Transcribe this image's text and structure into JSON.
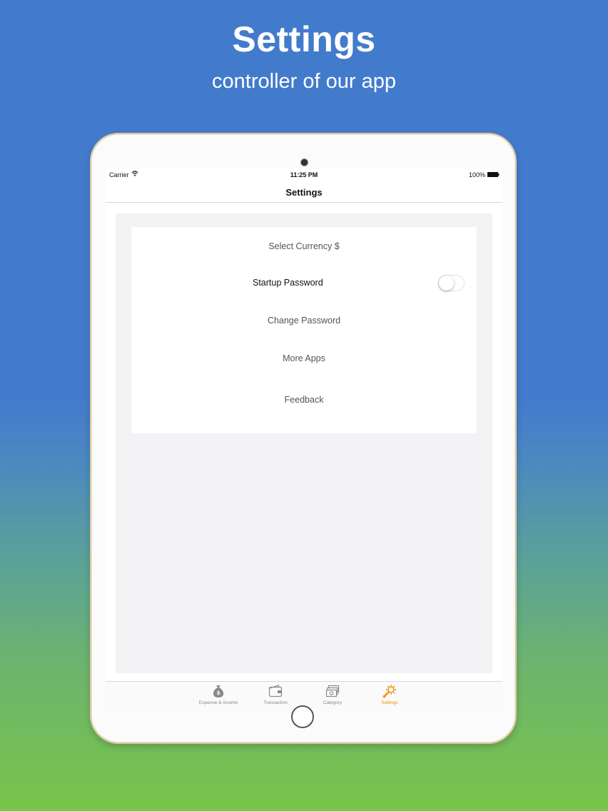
{
  "promo": {
    "title": "Settings",
    "subtitle": "controller of our app"
  },
  "status_bar": {
    "carrier": "Carrier",
    "time": "11:25 PM",
    "battery": "100%"
  },
  "nav": {
    "title": "Settings"
  },
  "settings": {
    "select_currency": "Select Currency $",
    "startup_password": "Startup Password",
    "startup_password_enabled": false,
    "change_password": "Change Password",
    "more_apps": "More Apps",
    "feedback": "Feedback"
  },
  "tabs": [
    {
      "label": "Expense & income",
      "icon": "money-bag-icon",
      "active": false
    },
    {
      "label": "Transaction",
      "icon": "wallet-icon",
      "active": false
    },
    {
      "label": "Category",
      "icon": "cash-stack-icon",
      "active": false
    },
    {
      "label": "Settings",
      "icon": "wrench-gear-icon",
      "active": true
    }
  ],
  "colors": {
    "tab_active": "#f0900a",
    "tab_inactive": "#888888",
    "background_top": "#437bcc",
    "background_bottom": "#79c44a"
  }
}
